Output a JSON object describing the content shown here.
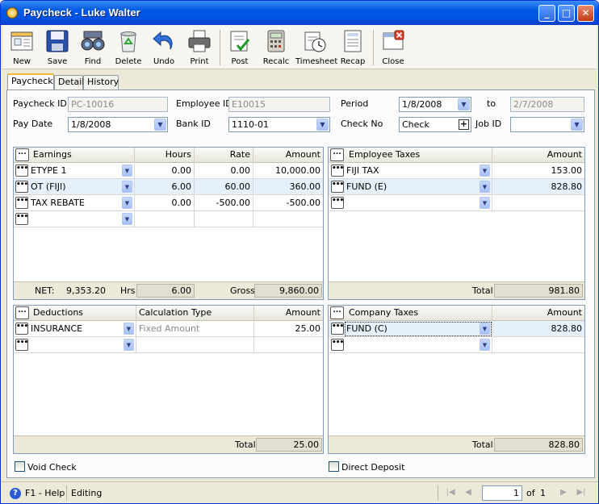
{
  "window": {
    "title": "Paycheck - Luke  Walter",
    "min": "_",
    "max": "□",
    "close": "✕"
  },
  "toolbar": {
    "new": "New",
    "save": "Save",
    "find": "Find",
    "delete": "Delete",
    "undo": "Undo",
    "print": "Print",
    "post": "Post",
    "recalc": "Recalc",
    "timesheet": "Timesheet",
    "recap": "Recap",
    "close": "Close"
  },
  "tabs": {
    "paycheck": "Paycheck",
    "detail": "Detail",
    "history": "History"
  },
  "form": {
    "paycheck_id_label": "Paycheck ID",
    "paycheck_id": "PC-10016",
    "employee_id_label": "Employee ID",
    "employee_id": "E10015",
    "period_label": "Period",
    "period_from": "1/8/2008",
    "to_label": "to",
    "period_to": "2/7/2008",
    "pay_date_label": "Pay Date",
    "pay_date": "1/8/2008",
    "bank_id_label": "Bank ID",
    "bank_id": "1110-01",
    "check_no_label": "Check No",
    "check_no": "Check",
    "job_id_label": "Job ID",
    "job_id": ""
  },
  "earnings": {
    "headers": {
      "btn": "...",
      "earnings": "Earnings",
      "hours": "Hours",
      "rate": "Rate",
      "amount": "Amount"
    },
    "rows": [
      {
        "earning": "ETYPE 1",
        "hours": "0.00",
        "rate": "0.00",
        "amount": "10,000.00"
      },
      {
        "earning": "OT (FIJI)",
        "hours": "6.00",
        "rate": "60.00",
        "amount": "360.00"
      },
      {
        "earning": "TAX REBATE",
        "hours": "0.00",
        "rate": "-500.00",
        "amount": "-500.00"
      }
    ],
    "footer": {
      "net_label": "NET:",
      "net": "9,353.20",
      "hrs_label": "Hrs",
      "hrs": "6.00",
      "gross_label": "Gross",
      "gross": "9,860.00"
    }
  },
  "employee_taxes": {
    "headers": {
      "btn": "...",
      "tax": "Employee Taxes",
      "amount": "Amount"
    },
    "rows": [
      {
        "tax": "FIJI TAX",
        "amount": "153.00"
      },
      {
        "tax": "FUND (E)",
        "amount": "828.80"
      }
    ],
    "footer": {
      "total_label": "Total",
      "total": "981.80"
    }
  },
  "deductions": {
    "headers": {
      "btn": "...",
      "deduction": "Deductions",
      "calc_type": "Calculation Type",
      "amount": "Amount"
    },
    "rows": [
      {
        "deduction": "INSURANCE",
        "calc_type": "Fixed Amount",
        "amount": "25.00"
      }
    ],
    "footer": {
      "total_label": "Total",
      "total": "25.00"
    }
  },
  "company_taxes": {
    "headers": {
      "btn": "...",
      "tax": "Company Taxes",
      "amount": "Amount"
    },
    "rows": [
      {
        "tax": "FUND (C)",
        "amount": "828.80"
      }
    ],
    "footer": {
      "total_label": "Total",
      "total": "828.80"
    }
  },
  "checks": {
    "void_check": "Void Check",
    "direct_deposit": "Direct Deposit"
  },
  "status": {
    "help": "F1 - Help",
    "mode": "Editing",
    "page": "1",
    "of_label": "of",
    "page_count": "1"
  },
  "icons": {
    "row_button": "•••",
    "dropdown": "▼",
    "plus": "+"
  }
}
